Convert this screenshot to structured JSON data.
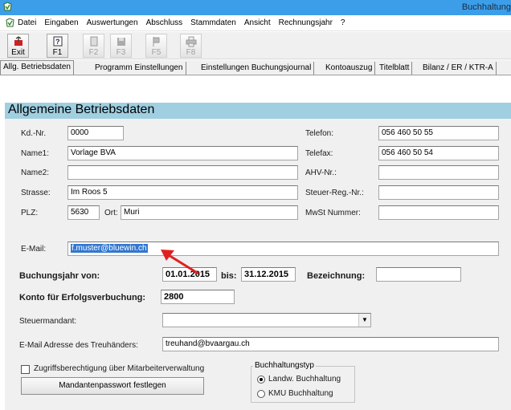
{
  "window": {
    "title": "Buchhaltung"
  },
  "menu": [
    "Datei",
    "Eingaben",
    "Auswertungen",
    "Abschluss",
    "Stammdaten",
    "Ansicht",
    "Rechnungsjahr",
    "?"
  ],
  "toolbar": {
    "buttons": [
      {
        "label": "Exit",
        "icon": "exit-icon"
      },
      {
        "label": "F1",
        "icon": "help-icon"
      },
      {
        "label": "F2",
        "icon": "document-icon"
      },
      {
        "label": "F3",
        "icon": "save-icon"
      },
      {
        "label": "F5",
        "icon": "flag-icon"
      },
      {
        "label": "F8",
        "icon": "print-icon"
      }
    ]
  },
  "tabs": [
    "Allg. Betriebsdaten",
    "Programm Einstellungen",
    "Einstellungen Buchungsjournal",
    "Kontoauszug",
    "Titelblatt",
    "Bilanz / ER / KTR-A"
  ],
  "section": {
    "title": "Allgemeine Betriebsdaten"
  },
  "form": {
    "kdnr": {
      "label": "Kd.-Nr.",
      "value": "0000"
    },
    "name1": {
      "label": "Name1:",
      "value": "Vorlage BVA"
    },
    "name2": {
      "label": "Name2:",
      "value": ""
    },
    "strasse": {
      "label": "Strasse:",
      "value": "Im Roos 5"
    },
    "plz": {
      "label": "PLZ:",
      "value": "5630"
    },
    "ort": {
      "label": "Ort:",
      "value": "Muri"
    },
    "email": {
      "label": "E-Mail:",
      "value": "f.muster@bluewin.ch"
    },
    "telefon": {
      "label": "Telefon:",
      "value": "056 460 50 55"
    },
    "telefax": {
      "label": "Telefax:",
      "value": "056 460 50 54"
    },
    "ahv": {
      "label": "AHV-Nr.:",
      "value": ""
    },
    "steuer_reg": {
      "label": "Steuer-Reg.-Nr.:",
      "value": ""
    },
    "mwst": {
      "label": "MwSt Nummer:",
      "value": ""
    },
    "buchungsjahr_von": {
      "label": "Buchungsjahr von:",
      "value": "01.01.2015"
    },
    "bis": {
      "label": "bis:",
      "value": "31.12.2015"
    },
    "bezeichnung": {
      "label": "Bezeichnung:",
      "value": ""
    },
    "konto_erfolg": {
      "label": "Konto für Erfolgsverbuchung:",
      "value": "2800"
    },
    "steuermandant": {
      "label": "Steuermandant:",
      "value": ""
    },
    "email_treuhaender": {
      "label": "E-Mail Adresse des Treuhänders:",
      "value": "treuhand@bvaargau.ch"
    },
    "zugriff": {
      "label": "Zugriffsberechtigung über Mitarbeiterverwaltung",
      "checked": false
    },
    "passwort_button": {
      "label": "Mandantenpasswort festlegen"
    },
    "buchhaltungstyp": {
      "title": "Buchhaltungstyp",
      "options": [
        "Landw. Buchhaltung",
        "KMU Buchhaltung"
      ],
      "selected": 0
    }
  },
  "colors": {
    "titlebar": "#3c9ee8",
    "header": "#9fcfe0",
    "selection": "#3277d0",
    "annotation_arrow": "#e02020"
  }
}
